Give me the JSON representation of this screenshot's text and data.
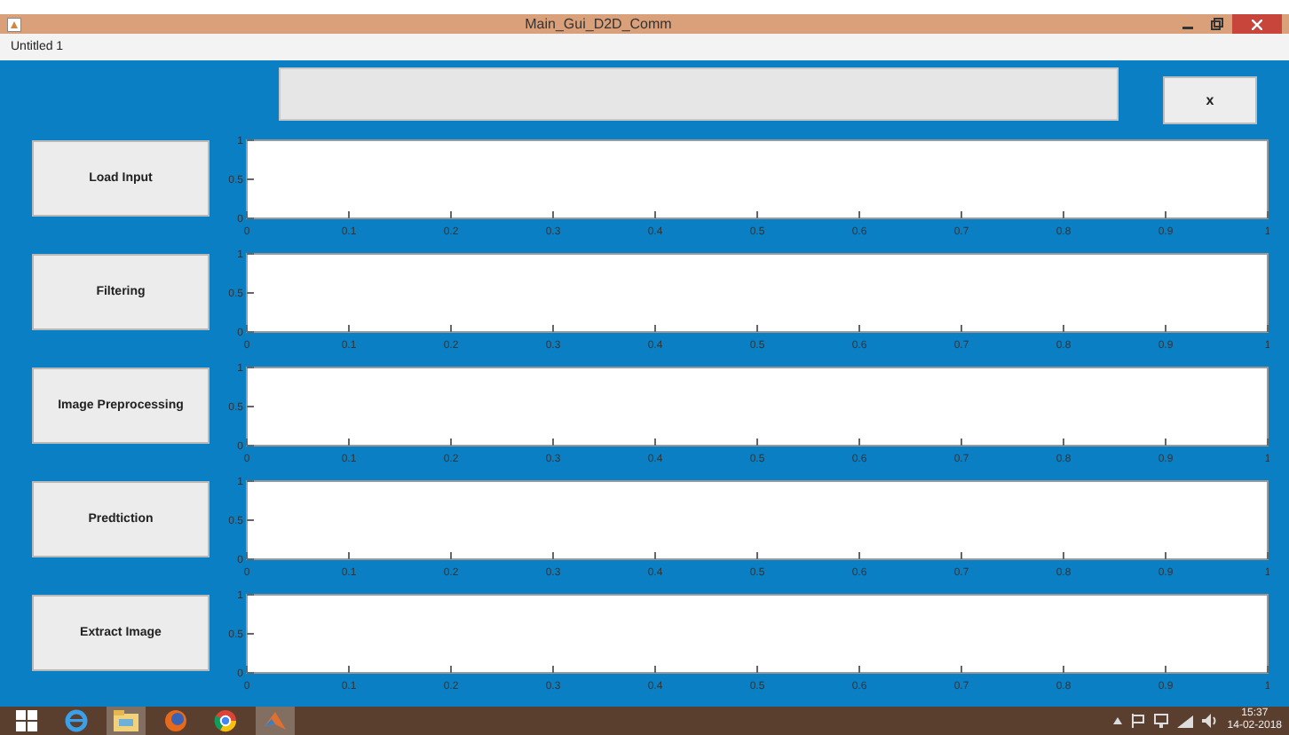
{
  "window": {
    "title": "Main_Gui_D2D_Comm"
  },
  "menu_bar": {
    "label": "Untitled 1"
  },
  "top": {
    "close_button": "x"
  },
  "panels": [
    {
      "button": "Load Input",
      "chart_data": {
        "type": "line",
        "xlim": [
          0,
          1
        ],
        "ylim": [
          0,
          1
        ],
        "xticks": [
          0,
          0.1,
          0.2,
          0.3,
          0.4,
          0.5,
          0.6,
          0.7,
          0.8,
          0.9,
          1
        ],
        "yticks": [
          0,
          0.5,
          1
        ]
      }
    },
    {
      "button": "Filtering",
      "chart_data": {
        "type": "line",
        "xlim": [
          0,
          1
        ],
        "ylim": [
          0,
          1
        ],
        "xticks": [
          0,
          0.1,
          0.2,
          0.3,
          0.4,
          0.5,
          0.6,
          0.7,
          0.8,
          0.9,
          1
        ],
        "yticks": [
          0,
          0.5,
          1
        ]
      }
    },
    {
      "button": "Image Preprocessing",
      "chart_data": {
        "type": "line",
        "xlim": [
          0,
          1
        ],
        "ylim": [
          0,
          1
        ],
        "xticks": [
          0,
          0.1,
          0.2,
          0.3,
          0.4,
          0.5,
          0.6,
          0.7,
          0.8,
          0.9,
          1
        ],
        "yticks": [
          0,
          0.5,
          1
        ]
      }
    },
    {
      "button": "Predtiction",
      "chart_data": {
        "type": "line",
        "xlim": [
          0,
          1
        ],
        "ylim": [
          0,
          1
        ],
        "xticks": [
          0,
          0.1,
          0.2,
          0.3,
          0.4,
          0.5,
          0.6,
          0.7,
          0.8,
          0.9,
          1
        ],
        "yticks": [
          0,
          0.5,
          1
        ]
      }
    },
    {
      "button": "Extract Image",
      "chart_data": {
        "type": "line",
        "xlim": [
          0,
          1
        ],
        "ylim": [
          0,
          1
        ],
        "xticks": [
          0,
          0.1,
          0.2,
          0.3,
          0.4,
          0.5,
          0.6,
          0.7,
          0.8,
          0.9,
          1
        ],
        "yticks": [
          0,
          0.5,
          1
        ]
      }
    }
  ],
  "taskbar": {
    "time": "15:37",
    "date": "14-02-2018"
  }
}
